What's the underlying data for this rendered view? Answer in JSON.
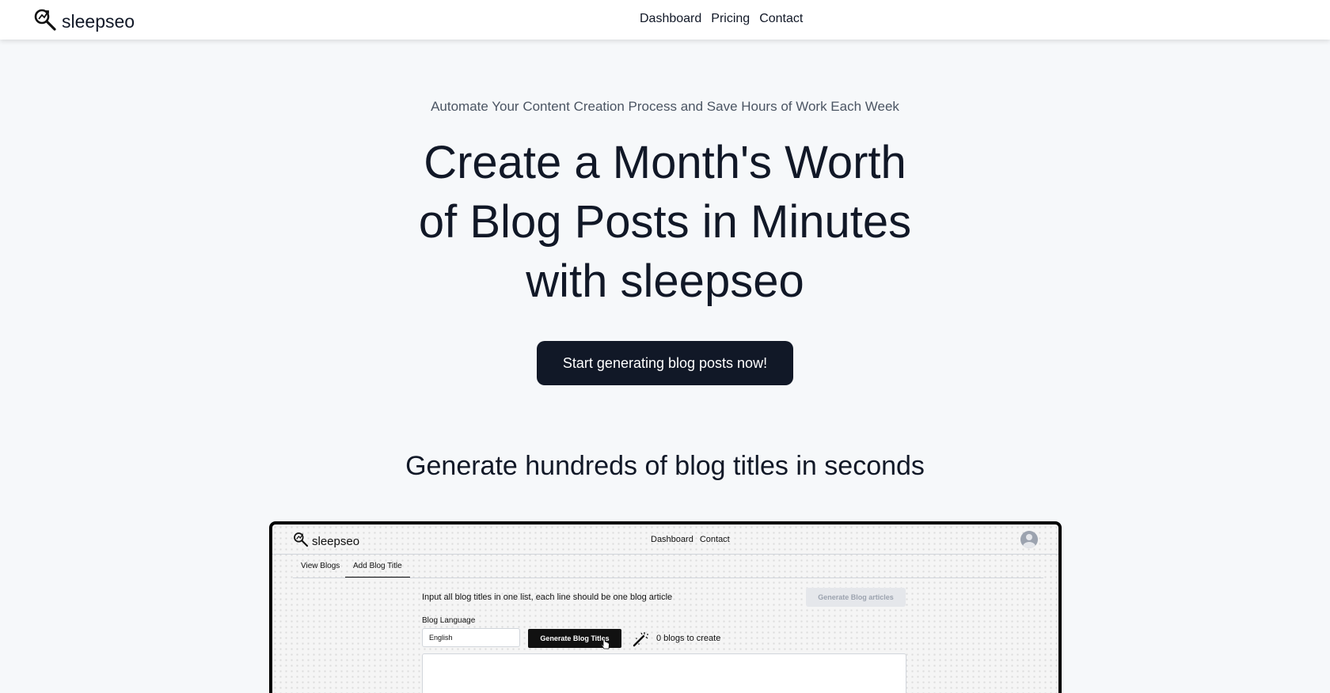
{
  "navbar": {
    "brand_name": "sleepseo",
    "links": [
      "Dashboard",
      "Pricing",
      "Contact"
    ]
  },
  "hero": {
    "eyebrow": "Automate Your Content Creation Process and Save Hours of Work Each Week",
    "title_lines": [
      "Create a Month's Worth",
      "of Blog Posts in Minutes",
      "with sleepseo"
    ],
    "cta_label": "Start generating blog posts now!"
  },
  "section": {
    "title": "Generate hundreds of blog titles in seconds"
  },
  "preview": {
    "brand_name": "sleepseo",
    "nav_links": [
      "Dashboard",
      "Contact"
    ],
    "tabs": [
      "View Blogs",
      "Add Blog Title"
    ],
    "active_tab": "Add Blog Title",
    "instruction": "Input all blog titles in one list, each line should be one blog article",
    "generate_articles_label": "Generate Blog articles",
    "language_label": "Blog Language",
    "language_value": "English",
    "generate_titles_label": "Generate Blog Titles",
    "blogs_count_text": "0 blogs to create"
  },
  "icons": {
    "brand": "magnifier-arrow-icon",
    "preview_brand": "magnifier-arrow-icon",
    "avatar": "user-avatar-icon",
    "wand": "magic-wand-icon",
    "cursor": "pointer-cursor-icon"
  },
  "colors": {
    "background": "#f6f8fa",
    "primary": "#111827",
    "navbar": "#ffffff",
    "muted_text": "#4b5563"
  }
}
